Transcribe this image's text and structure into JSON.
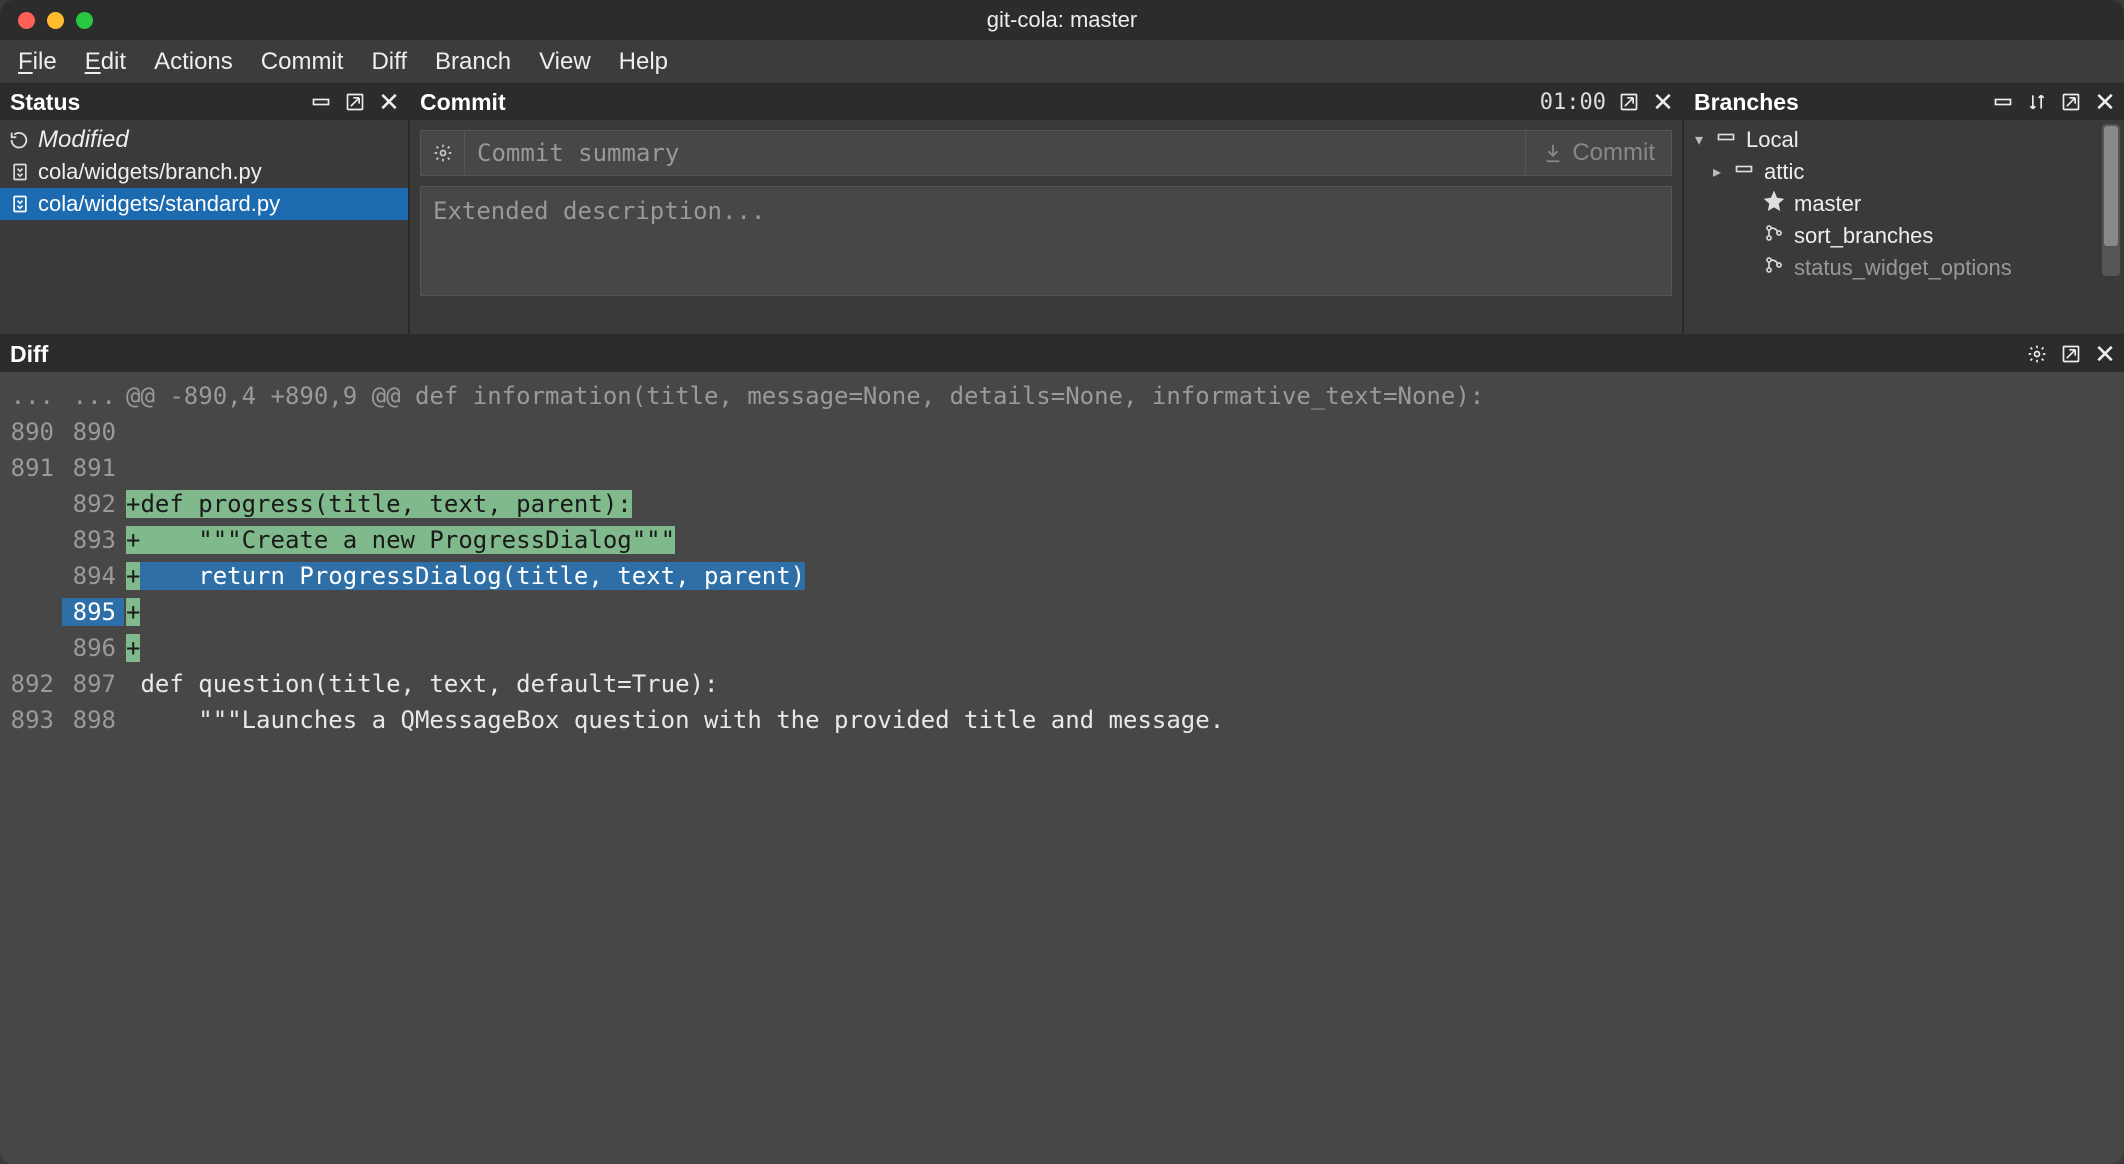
{
  "window": {
    "title": "git-cola: master"
  },
  "menu": {
    "file": "File",
    "edit": "Edit",
    "actions": "Actions",
    "commit": "Commit",
    "diff": "Diff",
    "branch": "Branch",
    "view": "View",
    "help": "Help"
  },
  "status": {
    "title": "Status",
    "modified_label": "Modified",
    "files": [
      {
        "path": "cola/widgets/branch.py",
        "selected": false
      },
      {
        "path": "cola/widgets/standard.py",
        "selected": true
      }
    ]
  },
  "commit": {
    "title": "Commit",
    "timer": "01:00",
    "summary_placeholder": "Commit summary",
    "summary_value": "",
    "description_placeholder": "Extended description...",
    "description_value": "",
    "commit_button": "Commit"
  },
  "branches": {
    "title": "Branches",
    "local_label": "Local",
    "items": [
      {
        "name": "attic",
        "icon": "folder",
        "depth": 1,
        "expander": true
      },
      {
        "name": "master",
        "icon": "star",
        "depth": 2,
        "expander": false
      },
      {
        "name": "sort_branches",
        "icon": "branch",
        "depth": 2,
        "expander": false
      },
      {
        "name": "status_widget_options",
        "icon": "branch",
        "depth": 2,
        "expander": false,
        "truncated": true
      }
    ]
  },
  "diff": {
    "title": "Diff",
    "hunk_header": "@@ -890,4 +890,9 @@ def information(title, message=None, details=None, informative_text=None):",
    "lines": [
      {
        "old": "...",
        "new": "...",
        "type": "hunk"
      },
      {
        "old": "890",
        "new": "890",
        "type": "ctx",
        "text": ""
      },
      {
        "old": "891",
        "new": "891",
        "type": "ctx",
        "text": ""
      },
      {
        "old": "",
        "new": "892",
        "type": "add",
        "text": "+def progress(title, text, parent):",
        "highlight": "add"
      },
      {
        "old": "",
        "new": "893",
        "type": "add",
        "text": "+    \"\"\"Create a new ProgressDialog\"\"\"",
        "highlight": "add"
      },
      {
        "old": "",
        "new": "894",
        "type": "add",
        "text": "+    return ProgressDialog(title, text, parent)",
        "highlight": "sel-partial"
      },
      {
        "old": "",
        "new": "895",
        "type": "add",
        "text": "+",
        "highlight": "sel-row"
      },
      {
        "old": "",
        "new": "896",
        "type": "add",
        "text": "+",
        "highlight": "add-tiny"
      },
      {
        "old": "892",
        "new": "897",
        "type": "ctx",
        "text": " def question(title, text, default=True):"
      },
      {
        "old": "893",
        "new": "898",
        "type": "ctx",
        "text": "     \"\"\"Launches a QMessageBox question with the provided title and message."
      }
    ]
  }
}
